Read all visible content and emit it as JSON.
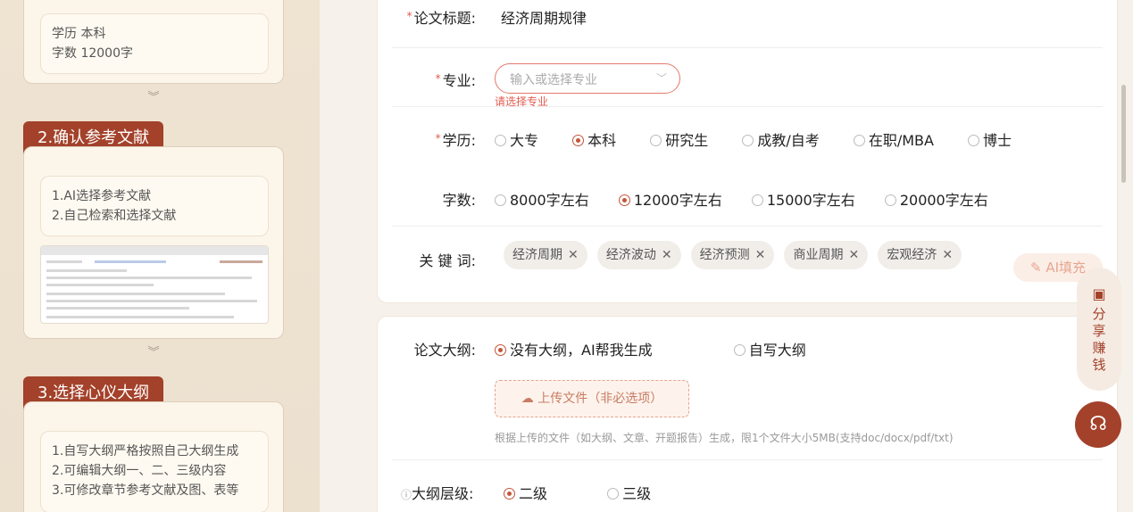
{
  "steps": {
    "step1_info": {
      "line1": "学历  本科",
      "line2": "字数  12000字"
    },
    "step2": {
      "title": "2.确认参考文献",
      "lines": [
        "1.AI选择参考文献",
        "2.自己检索和选择文献"
      ]
    },
    "step3": {
      "title": "3.选择心仪大纲",
      "lines": [
        "1.自写大纲严格按照自己大纲生成",
        "2.可编辑大纲一、二、三级内容",
        "3.可修改章节参考文献及图、表等"
      ]
    }
  },
  "form": {
    "title_label": "论文标题:",
    "title_value": "经济周期规律",
    "major_label": "专业:",
    "major_placeholder": "输入或选择专业",
    "major_error": "请选择专业",
    "edu_label": "学历:",
    "edu_options": [
      "大专",
      "本科",
      "研究生",
      "成教/自考",
      "在职/MBA",
      "博士"
    ],
    "edu_selected": "本科",
    "words_label": "字数:",
    "words_options": [
      "8000字左右",
      "12000字左右",
      "15000字左右",
      "20000字左右"
    ],
    "words_selected": "12000字左右",
    "keywords_label": "关 键 词:",
    "keywords": [
      "经济周期",
      "经济波动",
      "经济预测",
      "商业周期",
      "宏观经济"
    ],
    "ai_fill": "AI填充"
  },
  "outline": {
    "label": "论文大纲:",
    "options": [
      "没有大纲，AI帮我生成",
      "自写大纲"
    ],
    "selected": "没有大纲，AI帮我生成",
    "upload_label": "上传文件（非必选项）",
    "upload_hint": "根据上传的文件（如大纲、文章、开题报告）生成，限1个文件大小5MB(支持doc/docx/pdf/txt)",
    "level_label": "大纲层级:",
    "level_options": [
      "二级",
      "三级"
    ],
    "level_selected": "二级"
  },
  "floating": {
    "share": [
      "分",
      "享",
      "赚",
      "钱"
    ]
  },
  "icons": [
    "chevron-down-icon",
    "close-icon",
    "pen-sparkle-icon",
    "upload-cloud-icon",
    "help-circle-icon",
    "share-icon",
    "headset-icon"
  ],
  "colors": {
    "accent": "#a3412a",
    "error": "#e45b4f",
    "radio_on": "#c4553a"
  }
}
